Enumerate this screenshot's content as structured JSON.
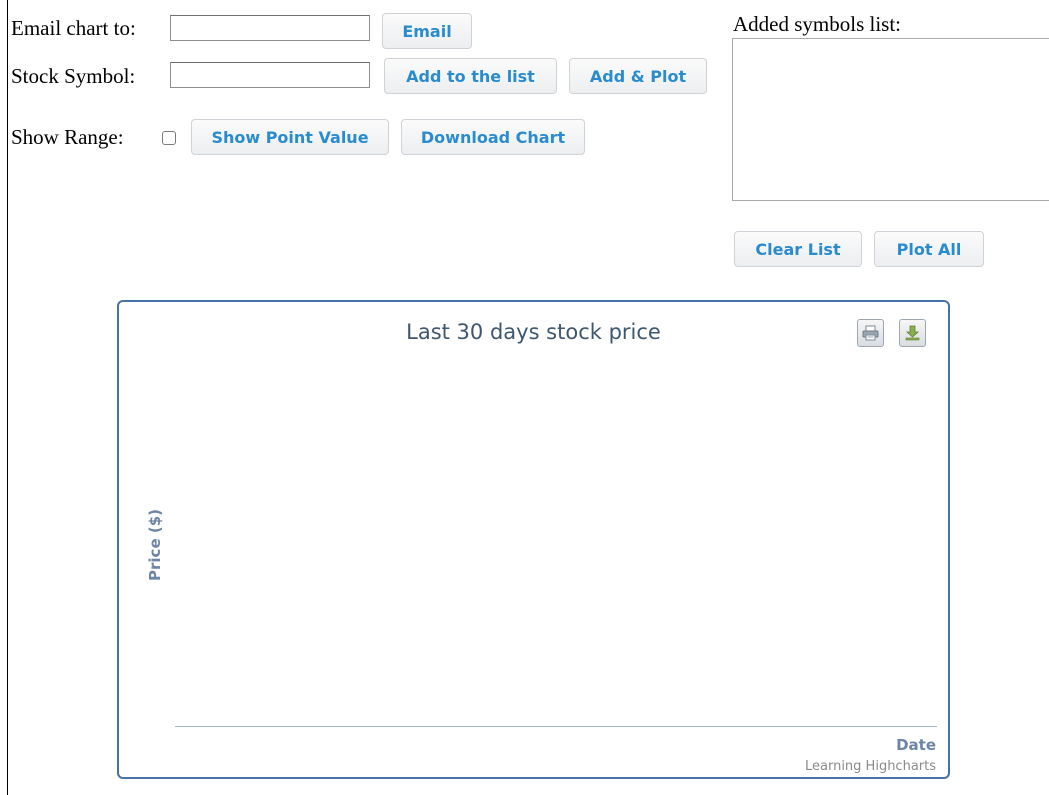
{
  "form": {
    "email_label": "Email chart to:",
    "email_value": "",
    "email_button": "Email",
    "symbol_label": "Stock Symbol:",
    "symbol_value": "",
    "add_to_list_button": "Add to the list",
    "add_and_plot_button": "Add & Plot",
    "show_range_label": "Show Range:",
    "show_range_checked": false,
    "show_point_value_button": "Show Point Value",
    "download_chart_button": "Download Chart"
  },
  "symbols_panel": {
    "label": "Added symbols list:",
    "items": [],
    "clear_button": "Clear List",
    "plot_all_button": "Plot All"
  },
  "chart": {
    "print_icon": "printer-icon",
    "export_icon": "download-icon"
  },
  "chart_data": {
    "type": "line",
    "title": "Last 30 days stock price",
    "xlabel": "Date",
    "ylabel": "Price ($)",
    "series": [],
    "credits": "Learning Highcharts",
    "colors": {
      "border": "#4572a7",
      "title": "#3e576f",
      "axis_title": "#6c85a6",
      "axis_line": "#a6b8d0"
    }
  }
}
